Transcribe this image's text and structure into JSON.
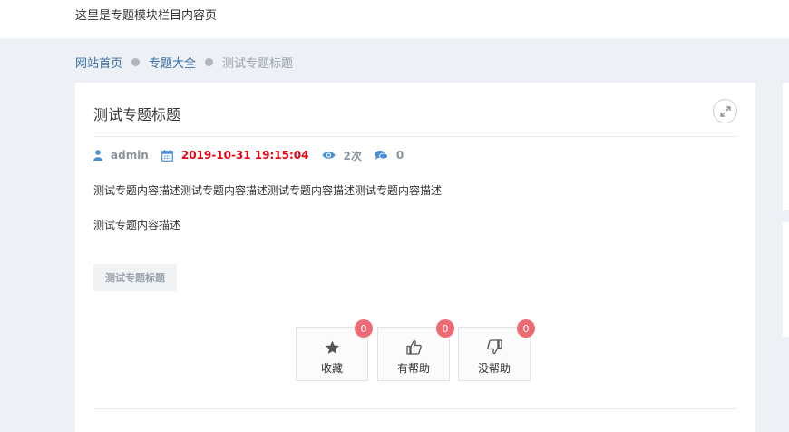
{
  "header": {
    "text": "这里是专题模块栏目内容页"
  },
  "breadcrumb": {
    "home": "网站首页",
    "section": "专题大全",
    "current": "测试专题标题"
  },
  "article": {
    "title": "测试专题标题",
    "author": "admin",
    "date": "2019-10-31 19:15:04",
    "views": "2次",
    "comments": "0",
    "paragraph1": "测试专题内容描述测试专题内容描述测试专题内容描述测试专题内容描述",
    "paragraph2": "测试专题内容描述",
    "tag": "测试专题标题"
  },
  "actions": [
    {
      "label": "收藏",
      "count": "0",
      "icon": "star-icon"
    },
    {
      "label": "有帮助",
      "count": "0",
      "icon": "thumbs-up-icon"
    },
    {
      "label": "没帮助",
      "count": "0",
      "icon": "thumbs-down-icon"
    }
  ],
  "colors": {
    "link": "#3a6ea5",
    "date": "#e60012",
    "badge": "#ef6b73",
    "meta_icon": "#4a8fd4"
  }
}
